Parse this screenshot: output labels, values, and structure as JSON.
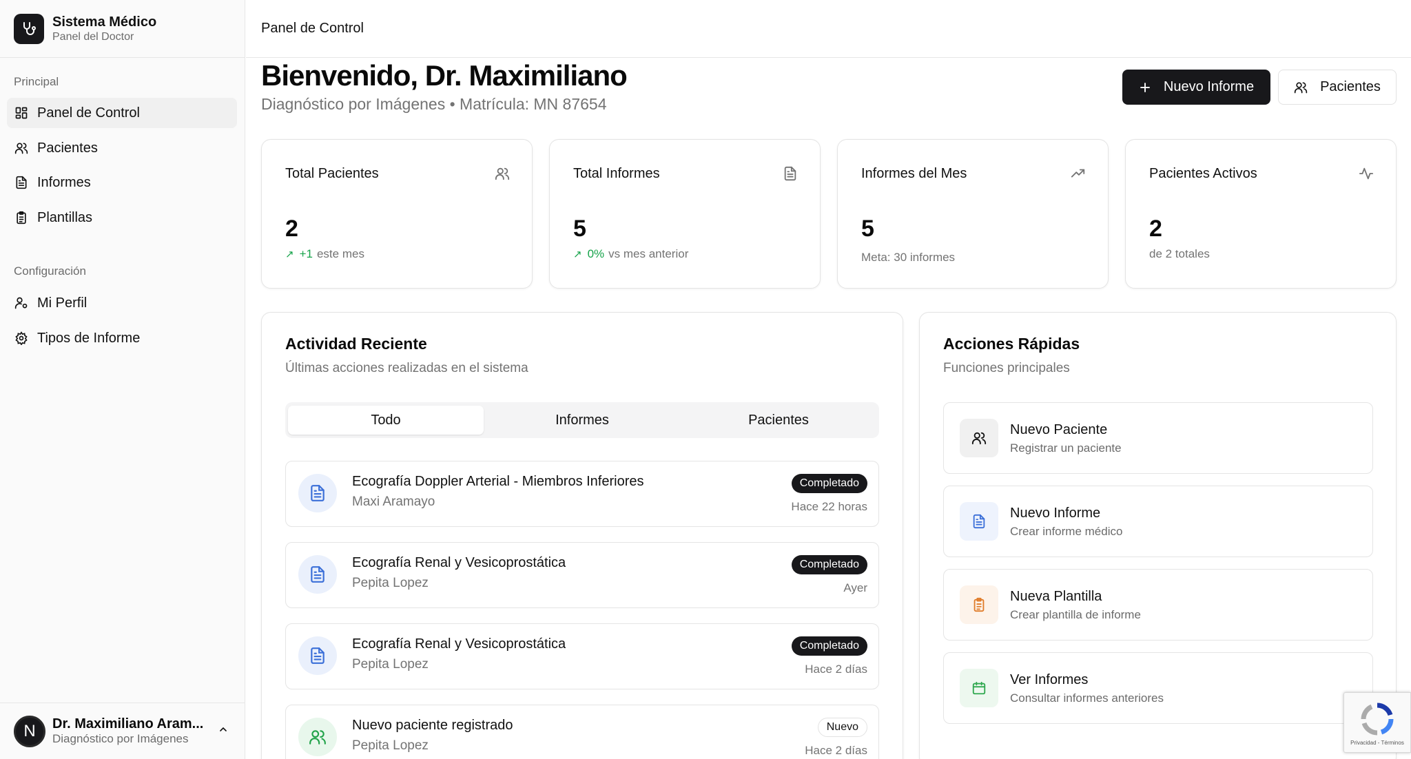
{
  "brand": {
    "title": "Sistema Médico",
    "subtitle": "Panel del Doctor"
  },
  "sidebar": {
    "section_principal": "Principal",
    "section_config": "Configuración",
    "items": [
      {
        "label": "Panel de Control",
        "icon": "dashboard-icon",
        "active": true
      },
      {
        "label": "Pacientes",
        "icon": "users-icon"
      },
      {
        "label": "Informes",
        "icon": "file-text-icon"
      },
      {
        "label": "Plantillas",
        "icon": "clipboard-icon"
      },
      {
        "label": "Mi Perfil",
        "icon": "user-cog-icon"
      },
      {
        "label": "Tipos de Informe",
        "icon": "settings-icon"
      }
    ]
  },
  "user": {
    "initial": "N",
    "name": "Dr. Maximiliano Aram...",
    "specialty": "Diagnóstico por Imágenes"
  },
  "header": {
    "breadcrumb": "Panel de Control"
  },
  "welcome": {
    "title": "Bienvenido, Dr. Maximiliano",
    "subtitle": "Diagnóstico por Imágenes • Matrícula: MN 87654",
    "new_report_label": "Nuevo Informe",
    "patients_label": "Pacientes"
  },
  "stats": [
    {
      "title": "Total Pacientes",
      "value": "2",
      "delta": "+1",
      "note": "este mes",
      "icon": "users-icon"
    },
    {
      "title": "Total Informes",
      "value": "5",
      "delta": "0%",
      "note": "vs mes anterior",
      "icon": "file-text-icon"
    },
    {
      "title": "Informes del Mes",
      "value": "5",
      "note": "Meta: 30 informes",
      "icon": "trending-up-icon"
    },
    {
      "title": "Pacientes Activos",
      "value": "2",
      "note": "de 2 totales",
      "icon": "activity-icon"
    }
  ],
  "activity": {
    "title": "Actividad Reciente",
    "subtitle": "Últimas acciones realizadas en el sistema",
    "tabs": [
      "Todo",
      "Informes",
      "Pacientes"
    ],
    "items": [
      {
        "title": "Ecografía Doppler Arterial - Miembros Inferiores",
        "patient": "Maxi Aramayo",
        "badge": "Completado",
        "time": "Hace 22 horas",
        "type": "report"
      },
      {
        "title": "Ecografía Renal y Vesicoprostática",
        "patient": "Pepita Lopez",
        "badge": "Completado",
        "time": "Ayer",
        "type": "report"
      },
      {
        "title": "Ecografía Renal y Vesicoprostática",
        "patient": "Pepita Lopez",
        "badge": "Completado",
        "time": "Hace 2 días",
        "type": "report"
      },
      {
        "title": "Nuevo paciente registrado",
        "patient": "Pepita Lopez",
        "badge": "Nuevo",
        "time": "Hace 2 días",
        "type": "patient"
      }
    ]
  },
  "quick_actions": {
    "title": "Acciones Rápidas",
    "subtitle": "Funciones principales",
    "items": [
      {
        "title": "Nuevo Paciente",
        "subtitle": "Registrar un paciente",
        "icon": "users-icon",
        "color": "#f0f0f0"
      },
      {
        "title": "Nuevo Informe",
        "subtitle": "Crear informe médico",
        "icon": "file-text-icon",
        "color": "#eef3fd"
      },
      {
        "title": "Nueva Plantilla",
        "subtitle": "Crear plantilla de informe",
        "icon": "clipboard-icon",
        "color": "#fdf3ea"
      },
      {
        "title": "Ver Informes",
        "subtitle": "Consultar informes anteriores",
        "icon": "calendar-icon",
        "color": "#edf8ef"
      }
    ]
  },
  "recaptcha": {
    "text": "Privacidad - Términos"
  }
}
